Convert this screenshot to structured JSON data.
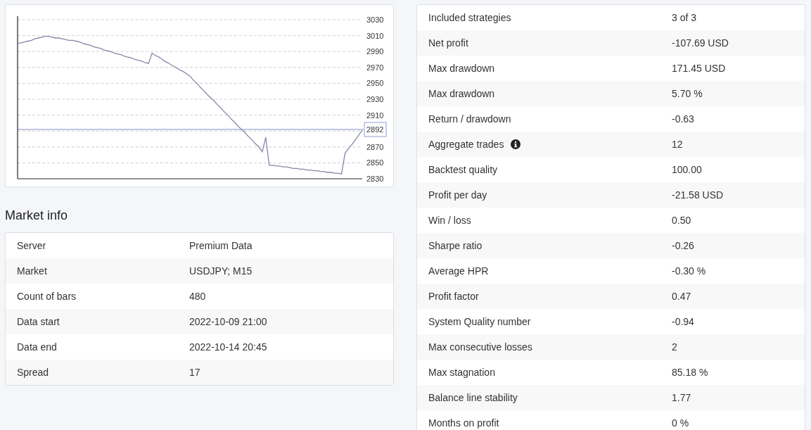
{
  "balance_chart": {
    "chart_data": {
      "type": "line",
      "categories": [
        null,
        null,
        null,
        null,
        null,
        null,
        null,
        null,
        null,
        null,
        null,
        null,
        null,
        null,
        null,
        null,
        null,
        null,
        null,
        null,
        null,
        null,
        null,
        null,
        null,
        null,
        null,
        null,
        null,
        null,
        null,
        null,
        null,
        null,
        null,
        null,
        null,
        null,
        null,
        null,
        null,
        null,
        null,
        null,
        null,
        null,
        null,
        null,
        null,
        null,
        null,
        null,
        null,
        null,
        null,
        null,
        null,
        null,
        null,
        null,
        null,
        null,
        null,
        null,
        null,
        null,
        null,
        null,
        null,
        null,
        null,
        null,
        null,
        null,
        null,
        null,
        null,
        null,
        null,
        null,
        null,
        null,
        null,
        null,
        null,
        null,
        null,
        null,
        null,
        null,
        null,
        null,
        null,
        null,
        null,
        null,
        null,
        null,
        null,
        null,
        null
      ],
      "series": [
        {
          "color": "#8a84a8",
          "values": [
            3000,
            3001,
            3002,
            3003,
            3004,
            3006,
            3007,
            3008,
            3009,
            3009,
            3008,
            3007,
            3007,
            3006,
            3005,
            3004,
            3004,
            3003,
            3002,
            3000,
            2999,
            2998,
            2996,
            2995,
            2994,
            2992,
            2991,
            2990,
            2988,
            2987,
            2986,
            2984,
            2983,
            2982,
            2980,
            2979,
            2978,
            2976,
            2975,
            2988,
            2985,
            2983,
            2980,
            2977,
            2975,
            2972,
            2970,
            2967,
            2965,
            2962,
            2959,
            2954,
            2950,
            2945,
            2941,
            2936,
            2932,
            2928,
            2923,
            2919,
            2914,
            2910,
            2905,
            2901,
            2896,
            2892,
            2888,
            2883,
            2879,
            2874,
            2870,
            2864,
            2882,
            2847,
            2847,
            2846,
            2846,
            2845,
            2845,
            2844,
            2843,
            2843,
            2842,
            2842,
            2841,
            2841,
            2840,
            2840,
            2839,
            2839,
            2838,
            2838,
            2837,
            2837,
            2836,
            2862,
            2868,
            2873,
            2879,
            2885,
            2891
          ]
        }
      ],
      "ylim": [
        2830,
        3030
      ],
      "yticks": [
        2830,
        2850,
        2870,
        {
          "value": 2892,
          "label": "2892"
        },
        2910,
        2930,
        2950,
        2970,
        2990,
        3010,
        3030
      ],
      "grid": true,
      "ref_lines": [
        {
          "axis": "y",
          "value": 2892
        }
      ]
    }
  },
  "market_info": {
    "title": "Market info",
    "rows": [
      {
        "label": "Server",
        "value": "Premium Data"
      },
      {
        "label": "Market",
        "value": "USDJPY; M15"
      },
      {
        "label": "Count of bars",
        "value": "480"
      },
      {
        "label": "Data start",
        "value": "2022-10-09 21:00"
      },
      {
        "label": "Data end",
        "value": "2022-10-14 20:45"
      },
      {
        "label": "Spread",
        "value": "17"
      }
    ]
  },
  "statistics": {
    "rows": [
      {
        "label": "Included strategies",
        "value": "3 of 3",
        "info_icon": false
      },
      {
        "label": "Net profit",
        "value": "-107.69 USD",
        "info_icon": false
      },
      {
        "label": "Max drawdown",
        "value": "171.45 USD",
        "info_icon": false
      },
      {
        "label": "Max drawdown",
        "value": "5.70 %",
        "info_icon": false
      },
      {
        "label": "Return / drawdown",
        "value": "-0.63",
        "info_icon": false
      },
      {
        "label": "Aggregate trades",
        "value": "12",
        "info_icon": true
      },
      {
        "label": "Backtest quality",
        "value": "100.00",
        "info_icon": false
      },
      {
        "label": "Profit per day",
        "value": "-21.58 USD",
        "info_icon": false
      },
      {
        "label": "Win / loss",
        "value": "0.50",
        "info_icon": false
      },
      {
        "label": "Sharpe ratio",
        "value": "-0.26",
        "info_icon": false
      },
      {
        "label": "Average HPR",
        "value": "-0.30 %",
        "info_icon": false
      },
      {
        "label": "Profit factor",
        "value": "0.47",
        "info_icon": false
      },
      {
        "label": "System Quality number",
        "value": "-0.94",
        "info_icon": false
      },
      {
        "label": "Max consecutive losses",
        "value": "2",
        "info_icon": false
      },
      {
        "label": "Max stagnation",
        "value": "85.18 %",
        "info_icon": false
      },
      {
        "label": "Balance line stability",
        "value": "1.77",
        "info_icon": false
      },
      {
        "label": "Months on profit",
        "value": "0 %",
        "info_icon": false
      }
    ]
  }
}
